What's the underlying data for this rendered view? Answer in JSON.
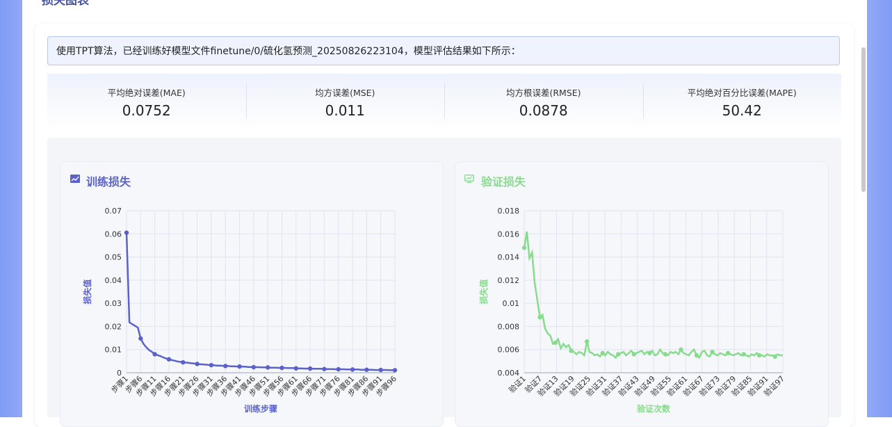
{
  "section_title": "损失图表",
  "message": "使用TPT算法，已经训练好模型文件finetune/0/硫化氢预测_20250826223104，模型评估结果如下所示：",
  "metrics": [
    {
      "label": "平均绝对误差(MAE)",
      "value": "0.0752"
    },
    {
      "label": "均方误差(MSE)",
      "value": "0.011"
    },
    {
      "label": "均方根误差(RMSE)",
      "value": "0.0878"
    },
    {
      "label": "平均绝对百分比误差(MAPE)",
      "value": "50.42"
    }
  ],
  "colors": {
    "train": "#5a62c9",
    "valid": "#86dc8c"
  },
  "icons": {
    "train": "line-chart-icon",
    "valid": "monitor-chart-icon"
  },
  "chart_data": [
    {
      "type": "line",
      "title": "训练损失",
      "xlabel": "训练步骤",
      "ylabel": "损失值",
      "ylim": [
        0,
        0.07
      ],
      "yticks": [
        "0",
        "0.01",
        "0.02",
        "0.03",
        "0.04",
        "0.05",
        "0.06",
        "0.07"
      ],
      "xtick_labels": [
        "步骤1",
        "步骤6",
        "步骤11",
        "步骤16",
        "步骤21",
        "步骤26",
        "步骤31",
        "步骤36",
        "步骤41",
        "步骤46",
        "步骤51",
        "步骤56",
        "步骤61",
        "步骤66",
        "步骤71",
        "步骤76",
        "步骤81",
        "步骤86",
        "步骤91",
        "步骤96"
      ],
      "n_points": 96,
      "x": [
        1,
        2,
        3,
        4,
        5,
        6,
        7,
        8,
        9,
        10,
        11,
        12,
        13,
        14,
        15,
        16,
        17,
        18,
        19,
        20,
        21,
        22,
        23,
        24,
        25,
        26,
        27,
        28,
        29,
        30,
        31,
        32,
        33,
        34,
        35,
        36,
        37,
        38,
        39,
        40,
        41,
        42,
        43,
        44,
        45,
        46,
        47,
        48,
        49,
        50,
        51,
        52,
        53,
        54,
        55,
        56,
        57,
        58,
        59,
        60,
        61,
        62,
        63,
        64,
        65,
        66,
        67,
        68,
        69,
        70,
        71,
        72,
        73,
        74,
        75,
        76,
        77,
        78,
        79,
        80,
        81,
        82,
        83,
        84,
        85,
        86,
        87,
        88,
        89,
        90,
        91,
        92,
        93,
        94,
        95,
        96
      ],
      "y": [
        0.0605,
        0.0218,
        0.021,
        0.0203,
        0.0195,
        0.0148,
        0.0125,
        0.011,
        0.0098,
        0.009,
        0.008,
        0.0076,
        0.0072,
        0.0066,
        0.0062,
        0.0058,
        0.0055,
        0.0052,
        0.0049,
        0.0047,
        0.0045,
        0.0044,
        0.0043,
        0.0041,
        0.004,
        0.0038,
        0.0037,
        0.0036,
        0.0035,
        0.0034,
        0.0033,
        0.0032,
        0.0031,
        0.0031,
        0.003,
        0.0029,
        0.0029,
        0.0028,
        0.0028,
        0.0027,
        0.0027,
        0.0026,
        0.0026,
        0.0025,
        0.0025,
        0.0024,
        0.0024,
        0.0024,
        0.0023,
        0.0023,
        0.0023,
        0.0022,
        0.0022,
        0.0022,
        0.0021,
        0.0021,
        0.0021,
        0.002,
        0.002,
        0.002,
        0.0019,
        0.0019,
        0.0019,
        0.0018,
        0.0018,
        0.0018,
        0.0017,
        0.0017,
        0.0017,
        0.0017,
        0.0016,
        0.0016,
        0.0016,
        0.0016,
        0.0015,
        0.0015,
        0.0015,
        0.0015,
        0.0014,
        0.0014,
        0.0014,
        0.0014,
        0.0014,
        0.0013,
        0.0013,
        0.0013,
        0.0013,
        0.0013,
        0.0012,
        0.0012,
        0.0012,
        0.0012,
        0.0012,
        0.0011,
        0.0011,
        0.0011
      ],
      "grid": true
    },
    {
      "type": "line",
      "title": "验证损失",
      "xlabel": "验证次数",
      "ylabel": "损失值",
      "ylim": [
        0.004,
        0.018
      ],
      "yticks": [
        "0.004",
        "0.006",
        "0.008",
        "0.01",
        "0.012",
        "0.014",
        "0.016",
        "0.018"
      ],
      "xtick_labels": [
        "验证1",
        "验证7",
        "验证13",
        "验证19",
        "验证25",
        "验证31",
        "验证37",
        "验证43",
        "验证49",
        "验证55",
        "验证61",
        "验证67",
        "验证73",
        "验证79",
        "验证85",
        "验证91",
        "验证97"
      ],
      "n_points": 100,
      "x": [
        1,
        2,
        3,
        4,
        5,
        6,
        7,
        8,
        9,
        10,
        11,
        12,
        13,
        14,
        15,
        16,
        17,
        18,
        19,
        20,
        21,
        22,
        23,
        24,
        25,
        26,
        27,
        28,
        29,
        30,
        31,
        32,
        33,
        34,
        35,
        36,
        37,
        38,
        39,
        40,
        41,
        42,
        43,
        44,
        45,
        46,
        47,
        48,
        49,
        50,
        51,
        52,
        53,
        54,
        55,
        56,
        57,
        58,
        59,
        60,
        61,
        62,
        63,
        64,
        65,
        66,
        67,
        68,
        69,
        70,
        71,
        72,
        73,
        74,
        75,
        76,
        77,
        78,
        79,
        80,
        81,
        82,
        83,
        84,
        85,
        86,
        87,
        88,
        89,
        90,
        91,
        92,
        93,
        94,
        95,
        96,
        97,
        98,
        99,
        100
      ],
      "y": [
        0.0148,
        0.0162,
        0.0139,
        0.0144,
        0.0118,
        0.0103,
        0.0088,
        0.009,
        0.0078,
        0.0074,
        0.0072,
        0.0065,
        0.0066,
        0.0069,
        0.0061,
        0.0065,
        0.0062,
        0.0064,
        0.0059,
        0.0058,
        0.0056,
        0.0058,
        0.0057,
        0.0055,
        0.0067,
        0.0058,
        0.0057,
        0.0055,
        0.0056,
        0.0054,
        0.0057,
        0.0055,
        0.0058,
        0.0056,
        0.0055,
        0.0053,
        0.0056,
        0.0057,
        0.0058,
        0.0055,
        0.0057,
        0.0059,
        0.0056,
        0.0057,
        0.0058,
        0.0059,
        0.0056,
        0.0058,
        0.0057,
        0.0059,
        0.0055,
        0.0056,
        0.006,
        0.0057,
        0.0056,
        0.0055,
        0.0058,
        0.0057,
        0.0058,
        0.0056,
        0.006,
        0.0057,
        0.0056,
        0.0055,
        0.0058,
        0.006,
        0.0055,
        0.0053,
        0.0058,
        0.0059,
        0.0055,
        0.0054,
        0.0058,
        0.0056,
        0.0055,
        0.0057,
        0.0056,
        0.0055,
        0.0057,
        0.0056,
        0.0055,
        0.0056,
        0.0057,
        0.0055,
        0.0056,
        0.0055,
        0.0054,
        0.0056,
        0.0055,
        0.0057,
        0.0055,
        0.0055,
        0.0054,
        0.0056,
        0.0055,
        0.0055,
        0.0054,
        0.0056,
        0.0055,
        0.0055
      ],
      "grid": true
    }
  ]
}
